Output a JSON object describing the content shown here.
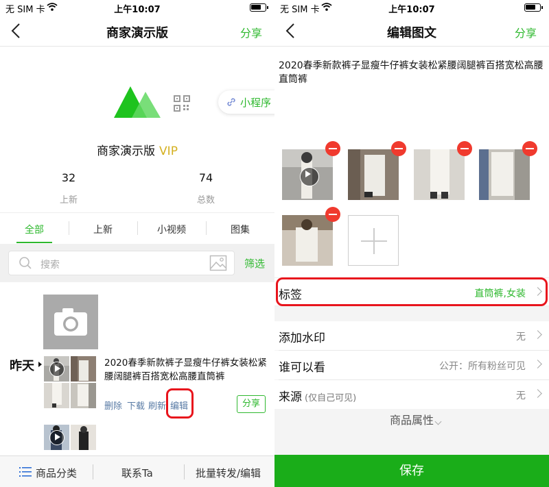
{
  "status_bar": {
    "carrier": "无 SIM 卡",
    "time": "上午10:07"
  },
  "left": {
    "nav": {
      "title": "商家演示版",
      "share": "分享"
    },
    "mini_program": "小程序",
    "shop": {
      "name": "商家演示版",
      "badge": "VIP"
    },
    "stats": [
      {
        "value": "32",
        "label": "上新"
      },
      {
        "value": "74",
        "label": "总数"
      }
    ],
    "tabs": [
      "全部",
      "上新",
      "小视频",
      "图集"
    ],
    "search": {
      "placeholder": "搜索",
      "filter": "筛选"
    },
    "feed": {
      "date_marker": "昨天",
      "description": "2020春季新款裤子显瘦牛仔裤女装松紧腰阔腿裤百搭宽松高腰直筒裤",
      "actions": [
        "删除",
        "下载",
        "刷新",
        "编辑"
      ],
      "share": "分享"
    },
    "bottom_bar": {
      "category": "商品分类",
      "contact": "联系Ta",
      "batch": "批量转发/编辑"
    }
  },
  "right": {
    "nav": {
      "title": "编辑图文",
      "share": "分享"
    },
    "description": "2020春季新款裤子显瘦牛仔裤女装松紧腰阔腿裤百搭宽松高腰直筒裤",
    "rows": {
      "tags": {
        "label": "标签",
        "value": "直筒裤,女装"
      },
      "watermark": {
        "label": "添加水印",
        "value": "无"
      },
      "visibility": {
        "label": "谁可以看",
        "value": "公开：所有粉丝可见"
      },
      "source": {
        "label": "来源",
        "hint": "(仅自己可见)",
        "value": "无"
      }
    },
    "attributes": "商品属性",
    "save": "保存"
  },
  "colors": {
    "accent_green": "#2eb82e",
    "highlight_red": "#e8141c",
    "delete_red": "#f03a2e"
  }
}
